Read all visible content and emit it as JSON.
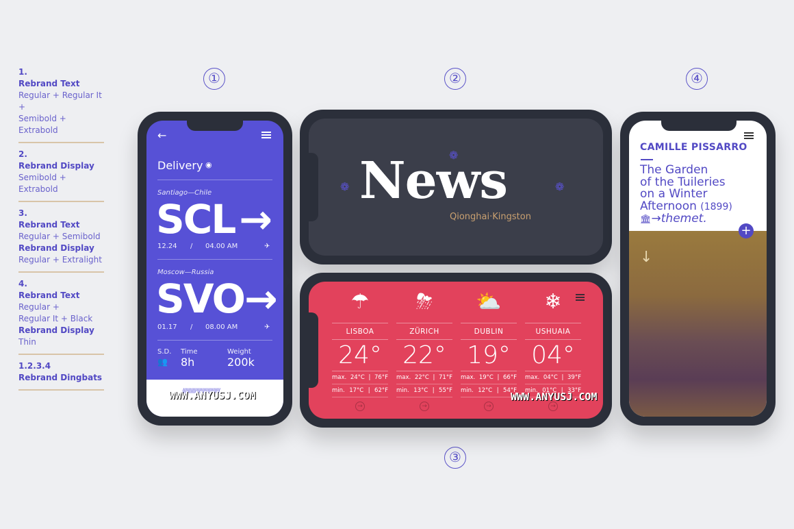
{
  "watermark": "www.anyusj.com",
  "legend": [
    {
      "num": "1.",
      "lines": [
        {
          "b": "Rebrand Text"
        },
        {
          "t": "Regular + Regular It +"
        },
        {
          "t": "Semibold + Extrabold"
        }
      ]
    },
    {
      "num": "2.",
      "lines": [
        {
          "b": "Rebrand Display"
        },
        {
          "t": "Semibold + Extrabold"
        }
      ]
    },
    {
      "num": "3.",
      "lines": [
        {
          "b": "Rebrand Text"
        },
        {
          "t": "Regular + Semibold"
        },
        {
          "b": "Rebrand Display"
        },
        {
          "t": "Regular + Extralight"
        }
      ]
    },
    {
      "num": "4.",
      "lines": [
        {
          "b": "Rebrand Text"
        },
        {
          "t": "Regular +"
        },
        {
          "t": "Regular It + Black"
        },
        {
          "b": "Rebrand Display"
        },
        {
          "t": "Thin"
        }
      ]
    },
    {
      "num": "1.2.3.4",
      "lines": [
        {
          "b": "Rebrand Dingbats"
        }
      ]
    }
  ],
  "numbers": {
    "n1": "①",
    "n2": "②",
    "n3": "③",
    "n4": "④"
  },
  "delivery": {
    "title": "Delivery",
    "from_city": "Santiago—Chile",
    "from_code": "SCL",
    "from_date": "12.24",
    "from_time": "04.00 AM",
    "to_city": "Moscow—Russia",
    "to_code": "SVO",
    "to_date": "01.17",
    "to_time": "08.00 AM",
    "sep": "/",
    "arrow": "→",
    "sd_label": "S.D.",
    "time_label": "Time",
    "time_value": "8h",
    "weight_label": "Weight",
    "weight_value": "200k",
    "barcode": "///////////////////////////",
    "wm": "WWW.ANYUSJ.COM"
  },
  "news": {
    "title": "News",
    "subtitle": "Qionghai·Kingston"
  },
  "weather": {
    "wm": "WWW.ANYUSJ.COM",
    "cities": [
      {
        "icon": "rain-cloud",
        "glyph": "☂",
        "city": "LISBOA",
        "temp": "24°",
        "max": "max.",
        "maxc": "24°C",
        "maxf": "76°F",
        "min": "min.",
        "minc": "17°C",
        "minf": "62°F"
      },
      {
        "icon": "storm-cloud",
        "glyph": "⛈",
        "city": "ZÜRICH",
        "temp": "22°",
        "max": "max.",
        "maxc": "22°C",
        "maxf": "71°F",
        "min": "min.",
        "minc": "13°C",
        "minf": "55°F"
      },
      {
        "icon": "partly-sunny",
        "glyph": "⛅",
        "city": "DUBLIN",
        "temp": "19°",
        "max": "max.",
        "maxc": "19°C",
        "maxf": "66°F",
        "min": "min.",
        "minc": "12°C",
        "minf": "54°F"
      },
      {
        "icon": "snow-cloud",
        "glyph": "❄",
        "city": "USHUAIA",
        "temp": "04°",
        "max": "max.",
        "maxc": "04°C",
        "maxf": "39°F",
        "min": "min.",
        "minc": "01°C",
        "minf": "33°F"
      }
    ]
  },
  "art": {
    "artist": "CAMILLE PISSARRO",
    "l1": "The Garden",
    "l2": "of the Tuileries",
    "l3": "on a Winter",
    "l4": "Afternoon",
    "year": "(1899)",
    "link": "→themet.",
    "accent": "#5249c4"
  }
}
